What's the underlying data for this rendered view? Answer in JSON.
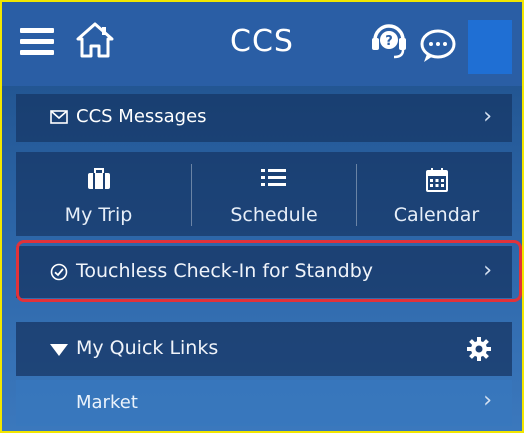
{
  "header": {
    "title": "CCS"
  },
  "messages": {
    "label": "CCS Messages"
  },
  "tiles": [
    {
      "label": "My Trip"
    },
    {
      "label": "Schedule"
    },
    {
      "label": "Calendar"
    }
  ],
  "checkin": {
    "label": "Touchless Check-In for Standby"
  },
  "quick_links": {
    "label": "My Quick Links",
    "items": [
      {
        "label": "Market"
      }
    ]
  },
  "icons": {
    "menu": "menu-icon",
    "home": "home-icon",
    "help": "help-headset-icon",
    "chat": "chat-icon",
    "mail": "mail-icon",
    "briefcase": "briefcase-icon",
    "list": "list-icon",
    "calendar": "calendar-icon",
    "check": "check-circle-icon",
    "caret": "caret-down-icon",
    "gear": "gear-icon",
    "chevron": "chevron-right-icon"
  },
  "colors": {
    "header_bg": "#2a5ea5",
    "highlight": "#e1323a",
    "frame": "#f2e600"
  }
}
